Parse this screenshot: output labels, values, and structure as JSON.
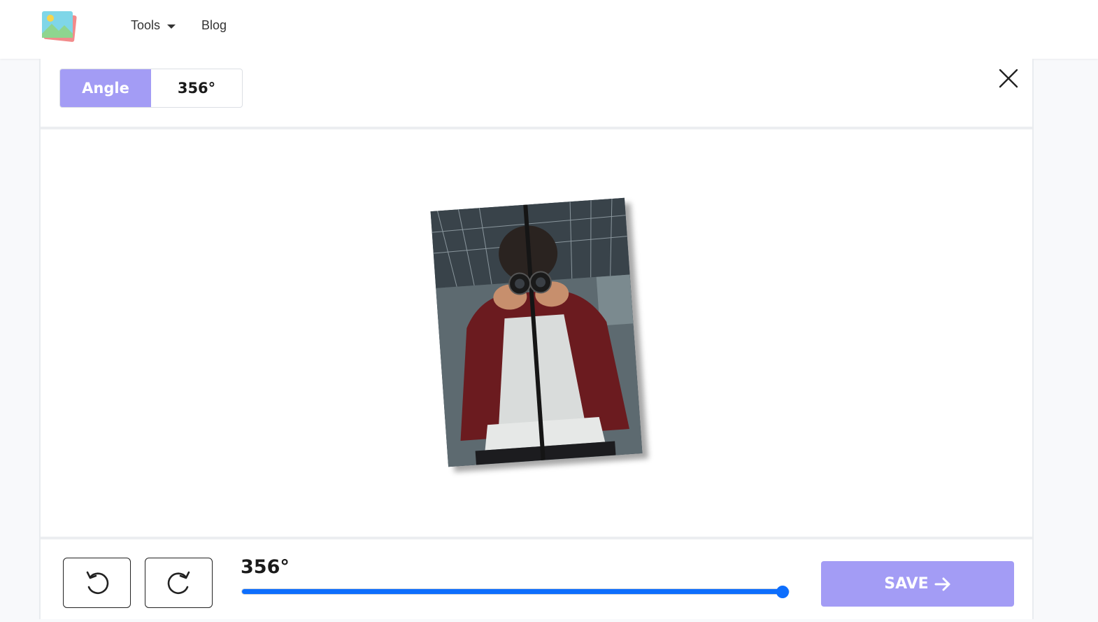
{
  "nav": {
    "logo_icon": "image-gallery-icon",
    "tools_label": "Tools",
    "blog_label": "Blog"
  },
  "toolbar": {
    "angle_label": "Angle",
    "angle_value": "356°",
    "close_icon": "close-icon"
  },
  "canvas": {
    "rotation_degrees": 356,
    "image_icon": "photo-preview"
  },
  "controls": {
    "rotate_left_icon": "rotate-ccw-icon",
    "rotate_right_icon": "rotate-cw-icon",
    "slider_label": "356°",
    "slider_min": 0,
    "slider_max": 360,
    "slider_value": 356,
    "save_label": "SAVE",
    "save_icon": "arrow-right-icon"
  },
  "colors": {
    "accent": "#a39cf5",
    "slider": "#0d6efd"
  }
}
